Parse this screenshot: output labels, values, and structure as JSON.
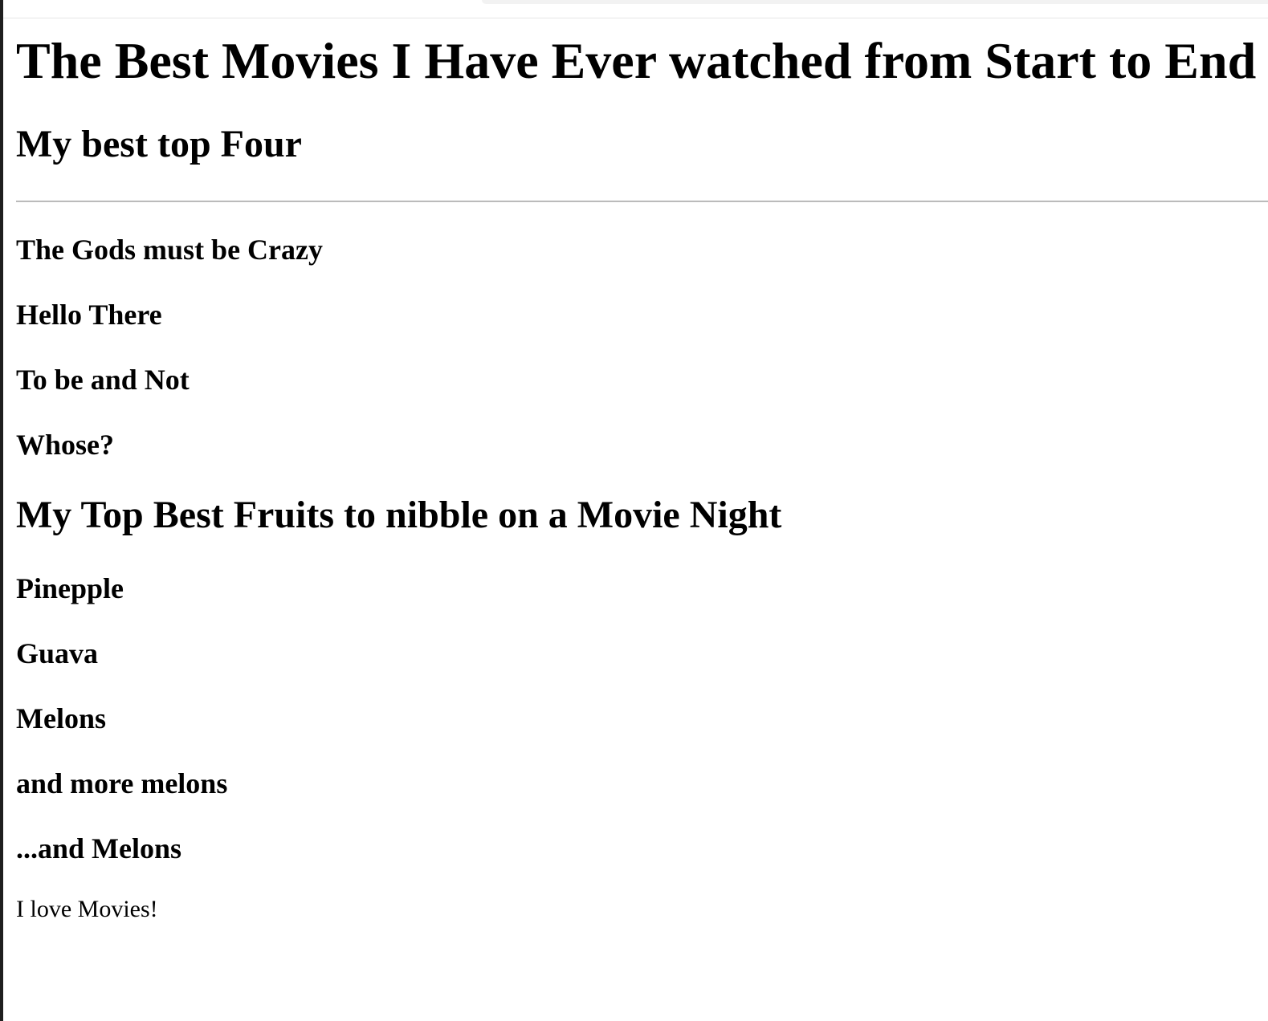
{
  "page": {
    "title": "The Best Movies I Have Ever watched from Start to End",
    "movies_heading": "My best top Four",
    "movies": [
      "The Gods must be Crazy",
      "Hello There",
      "To be and Not",
      "Whose?"
    ],
    "fruits_heading": "My Top Best Fruits to nibble on a Movie Night",
    "fruits": [
      "Pinepple",
      "Guava",
      "Melons",
      "and more melons",
      "...and Melons"
    ],
    "footer": "I love Movies!"
  }
}
